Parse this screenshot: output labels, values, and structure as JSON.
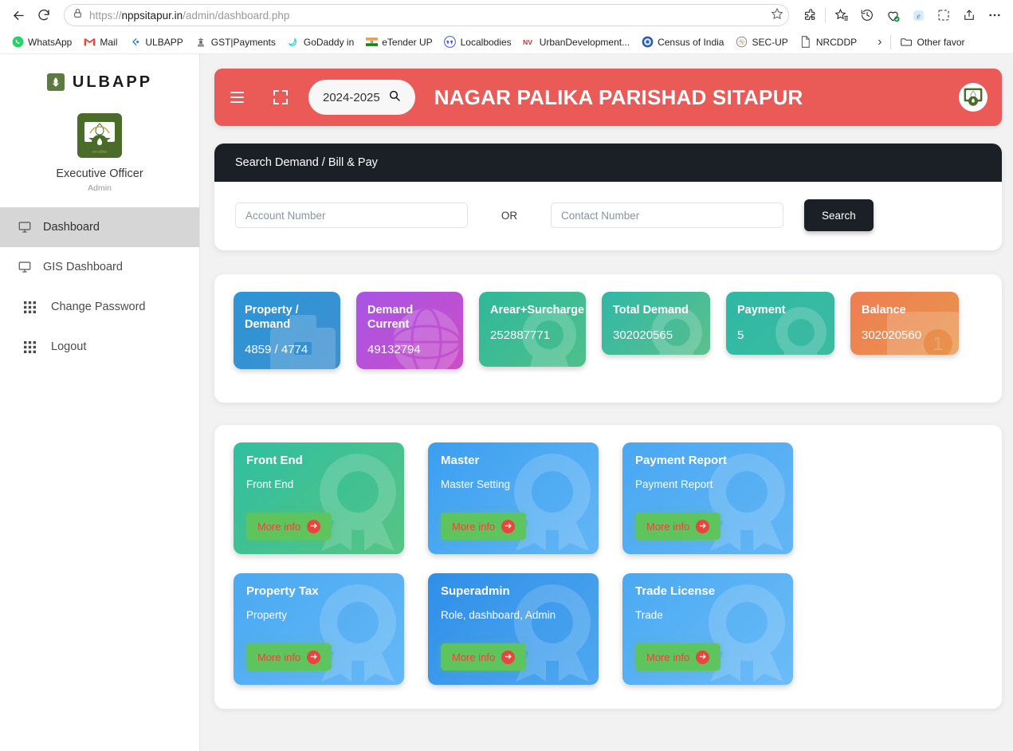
{
  "browser": {
    "url_prefix": "https://",
    "url_domain": "nppsitapur.in",
    "url_path": "/admin/dashboard.php",
    "back_icon": "back-arrow-icon",
    "reload_icon": "reload-icon",
    "lock_icon": "lock-icon",
    "star_icon": "star-outline-icon",
    "right_icons": [
      "extensions-icon",
      "favorites-icon",
      "history-icon",
      "collections-icon",
      "browser-essentials-icon",
      "screenshot-icon",
      "share-icon",
      "settings-more-icon"
    ],
    "bookmarks": [
      {
        "label": "WhatsApp",
        "icon": "whatsapp-icon",
        "color": "#25D366"
      },
      {
        "label": "Mail",
        "icon": "gmail-icon",
        "color": "#EA4335"
      },
      {
        "label": "ULBAPP",
        "icon": "ulbapp-icon",
        "color": "#2a7fd4"
      },
      {
        "label": "GST|Payments",
        "icon": "emblem-icon",
        "color": "#6b6b6b"
      },
      {
        "label": "GoDaddy in",
        "icon": "godaddy-icon",
        "color": "#1BDBDB"
      },
      {
        "label": "eTender UP",
        "icon": "india-flag-icon",
        "color": "#FF9933"
      },
      {
        "label": "Localbodies",
        "icon": "wordpress-icon",
        "color": "#3858E9"
      },
      {
        "label": "UrbanDevelopment...",
        "icon": "nv-icon",
        "color": "#d32f2f"
      },
      {
        "label": "Census of India",
        "icon": "census-icon",
        "color": "#2b5ca8"
      },
      {
        "label": "SEC-UP",
        "icon": "sec-up-icon",
        "color": "#7a7a7a"
      },
      {
        "label": "NRCDDP",
        "icon": "document-icon",
        "color": "#5a5a5a"
      }
    ],
    "overflow_label": "›",
    "other_favorites": "Other favor"
  },
  "sidebar": {
    "brand": "ULBAPP",
    "brand_icon": "ulbapp-crest-icon",
    "profile": {
      "crest_icon": "municipality-crest-icon",
      "name": "Executive Officer",
      "role": "Admin"
    },
    "items": [
      {
        "label": "Dashboard",
        "icon": "monitor-icon",
        "active": true
      },
      {
        "label": "GIS Dashboard",
        "icon": "monitor-icon",
        "active": false
      },
      {
        "label": "Change Password",
        "icon": "grid-icon",
        "active": false
      },
      {
        "label": "Logout",
        "icon": "grid-icon",
        "active": false
      }
    ]
  },
  "topbar": {
    "menu_icon": "hamburger-icon",
    "fullscreen_icon": "expand-icon",
    "year_value": "2024-2025",
    "year_search_icon": "search-icon",
    "title": "NAGAR PALIKA PARISHAD SITAPUR",
    "crest_icon": "municipality-crest-icon",
    "background_color": "#ea5a56"
  },
  "search_panel": {
    "heading": "Search Demand / Bill & Pay",
    "account_placeholder": "Account Number",
    "account_value": "",
    "or_label": "OR",
    "contact_placeholder": "Contact Number",
    "contact_value": "",
    "search_button": "Search"
  },
  "stats": [
    {
      "title": "Property / Demand",
      "value": "4859 / 4774",
      "color_from": "#2b95d6",
      "color_to": "#3d8fd1",
      "watermark": "briefcase-icon",
      "size": "tall"
    },
    {
      "title": "Demand Current",
      "value": "49132794",
      "color_from": "#a855e6",
      "color_to": "#c94dc9",
      "watermark": "globe-icon",
      "size": "tall"
    },
    {
      "title": "Arear+Surcharge",
      "value": "252887771",
      "color_from": "#2fb89a",
      "color_to": "#4cbf8e",
      "watermark": "badge-icon",
      "size": "tall"
    },
    {
      "title": "Total Demand",
      "value": "302020565",
      "color_from": "#2fb8a6",
      "color_to": "#5cc08c",
      "watermark": "badge-icon",
      "size": "mid"
    },
    {
      "title": "Payment",
      "value": "5",
      "color_from": "#2fb8a6",
      "color_to": "#3cbba0",
      "watermark": "badge-icon",
      "size": "mid"
    },
    {
      "title": "Balance",
      "value": "302020560",
      "color_from": "#ef7d54",
      "color_to": "#e8964b",
      "watermark": "wallet-icon",
      "size": "mid"
    }
  ],
  "modules": [
    {
      "title": "Front End",
      "subtitle": "Front End",
      "button": "More info",
      "color_from": "#2fbfa0",
      "color_to": "#57c484",
      "watermark": "award-ribbon-icon"
    },
    {
      "title": "Master",
      "subtitle": "Master Setting",
      "button": "More info",
      "color_from": "#3a9ff0",
      "color_to": "#63b6f5",
      "watermark": "award-ribbon-icon"
    },
    {
      "title": "Payment Report",
      "subtitle": "Payment Report",
      "button": "More info",
      "color_from": "#49a8f2",
      "color_to": "#63b6f5",
      "watermark": "award-ribbon-icon"
    },
    {
      "title": "Property Tax",
      "subtitle": "Property",
      "button": "More info",
      "color_from": "#4aa9f2",
      "color_to": "#65b8f6",
      "watermark": "award-ribbon-icon"
    },
    {
      "title": "Superadmin",
      "subtitle": "Role, dashboard, Admin",
      "button": "More info",
      "color_from": "#2f8fe8",
      "color_to": "#4fa8f0",
      "watermark": "award-ribbon-icon"
    },
    {
      "title": "Trade License",
      "subtitle": "Trade",
      "button": "More info",
      "color_from": "#4aa9f2",
      "color_to": "#6cbcf7",
      "watermark": "award-ribbon-icon"
    }
  ]
}
